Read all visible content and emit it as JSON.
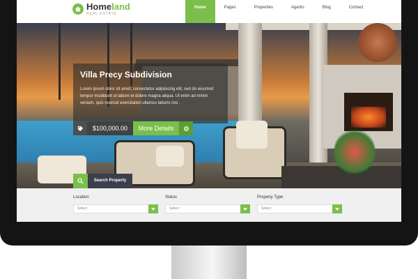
{
  "brand": {
    "name_part1": "Home",
    "name_part2": "land",
    "tagline": "REAL ESTATE",
    "accent_color": "#7bbf4a",
    "logo_icon": "house-icon"
  },
  "nav": {
    "items": [
      {
        "label": "Home",
        "active": true
      },
      {
        "label": "Pages",
        "active": false
      },
      {
        "label": "Properties",
        "active": false
      },
      {
        "label": "Agents",
        "active": false
      },
      {
        "label": "Blog",
        "active": false
      },
      {
        "label": "Contact",
        "active": false
      }
    ]
  },
  "hero": {
    "title": "Villa Precy Subdivision",
    "description": "Lorem ipsum dolor sit amet, consectetur adipisicing elit, sed do eiusmod tempor incididunt ut labore et dolore magna aliqua. Ut enim ad minim veniam, quis nostrud exercitation ullamco laboris nisi .",
    "price": "$100,000.00",
    "more_label": "More Details",
    "search_label": "Search Property"
  },
  "search_form": {
    "fields": [
      {
        "label": "Location",
        "value": "Select"
      },
      {
        "label": "Status",
        "value": "Select"
      },
      {
        "label": "Property Type",
        "value": "Select"
      }
    ]
  }
}
